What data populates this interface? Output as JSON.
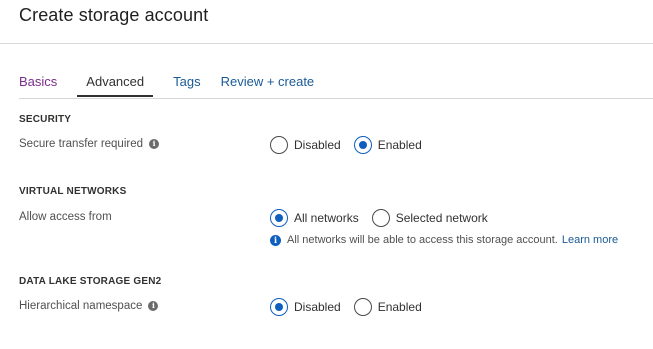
{
  "page": {
    "title": "Create storage account"
  },
  "tabs": [
    {
      "label": "Basics",
      "state": "visited"
    },
    {
      "label": "Advanced",
      "state": "active"
    },
    {
      "label": "Tags",
      "state": "link"
    },
    {
      "label": "Review + create",
      "state": "link"
    }
  ],
  "security": {
    "heading": "SECURITY",
    "secure_transfer": {
      "label": "Secure transfer required",
      "options": [
        {
          "label": "Disabled",
          "selected": false
        },
        {
          "label": "Enabled",
          "selected": true
        }
      ]
    }
  },
  "virtual_networks": {
    "heading": "VIRTUAL NETWORKS",
    "allow_access": {
      "label": "Allow access from",
      "options": [
        {
          "label": "All networks",
          "selected": true
        },
        {
          "label": "Selected network",
          "selected": false
        }
      ],
      "hint": "All networks will be able to access this storage account.",
      "hint_link": "Learn more"
    }
  },
  "data_lake": {
    "heading": "DATA LAKE STORAGE GEN2",
    "hierarchical_namespace": {
      "label": "Hierarchical namespace",
      "options": [
        {
          "label": "Disabled",
          "selected": true
        },
        {
          "label": "Enabled",
          "selected": false
        }
      ]
    }
  },
  "icons": {
    "info": "info-icon",
    "radio": "radio-button"
  },
  "colors": {
    "accent": "#0f5fbf",
    "link": "#1a5a96",
    "visited": "#7a2e8a"
  }
}
